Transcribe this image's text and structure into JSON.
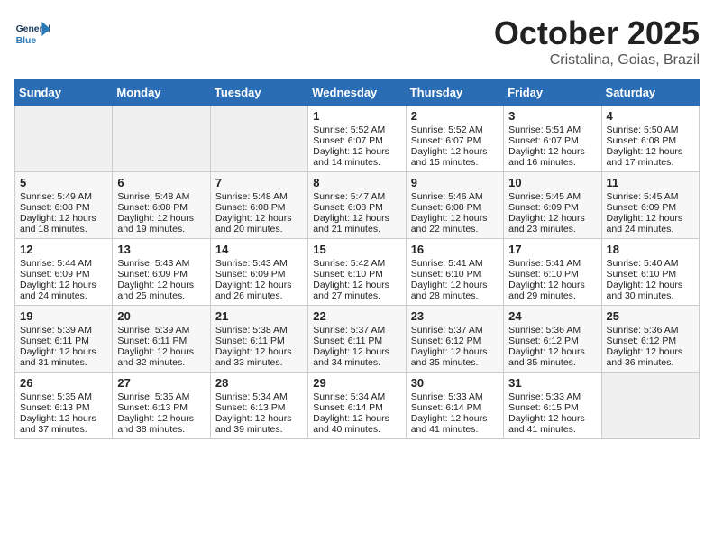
{
  "header": {
    "logo_general": "General",
    "logo_blue": "Blue",
    "month": "October 2025",
    "location": "Cristalina, Goias, Brazil"
  },
  "weekdays": [
    "Sunday",
    "Monday",
    "Tuesday",
    "Wednesday",
    "Thursday",
    "Friday",
    "Saturday"
  ],
  "weeks": [
    [
      {
        "day": "",
        "info": ""
      },
      {
        "day": "",
        "info": ""
      },
      {
        "day": "",
        "info": ""
      },
      {
        "day": "1",
        "info": "Sunrise: 5:52 AM\nSunset: 6:07 PM\nDaylight: 12 hours and 14 minutes."
      },
      {
        "day": "2",
        "info": "Sunrise: 5:52 AM\nSunset: 6:07 PM\nDaylight: 12 hours and 15 minutes."
      },
      {
        "day": "3",
        "info": "Sunrise: 5:51 AM\nSunset: 6:07 PM\nDaylight: 12 hours and 16 minutes."
      },
      {
        "day": "4",
        "info": "Sunrise: 5:50 AM\nSunset: 6:08 PM\nDaylight: 12 hours and 17 minutes."
      }
    ],
    [
      {
        "day": "5",
        "info": "Sunrise: 5:49 AM\nSunset: 6:08 PM\nDaylight: 12 hours and 18 minutes."
      },
      {
        "day": "6",
        "info": "Sunrise: 5:48 AM\nSunset: 6:08 PM\nDaylight: 12 hours and 19 minutes."
      },
      {
        "day": "7",
        "info": "Sunrise: 5:48 AM\nSunset: 6:08 PM\nDaylight: 12 hours and 20 minutes."
      },
      {
        "day": "8",
        "info": "Sunrise: 5:47 AM\nSunset: 6:08 PM\nDaylight: 12 hours and 21 minutes."
      },
      {
        "day": "9",
        "info": "Sunrise: 5:46 AM\nSunset: 6:08 PM\nDaylight: 12 hours and 22 minutes."
      },
      {
        "day": "10",
        "info": "Sunrise: 5:45 AM\nSunset: 6:09 PM\nDaylight: 12 hours and 23 minutes."
      },
      {
        "day": "11",
        "info": "Sunrise: 5:45 AM\nSunset: 6:09 PM\nDaylight: 12 hours and 24 minutes."
      }
    ],
    [
      {
        "day": "12",
        "info": "Sunrise: 5:44 AM\nSunset: 6:09 PM\nDaylight: 12 hours and 24 minutes."
      },
      {
        "day": "13",
        "info": "Sunrise: 5:43 AM\nSunset: 6:09 PM\nDaylight: 12 hours and 25 minutes."
      },
      {
        "day": "14",
        "info": "Sunrise: 5:43 AM\nSunset: 6:09 PM\nDaylight: 12 hours and 26 minutes."
      },
      {
        "day": "15",
        "info": "Sunrise: 5:42 AM\nSunset: 6:10 PM\nDaylight: 12 hours and 27 minutes."
      },
      {
        "day": "16",
        "info": "Sunrise: 5:41 AM\nSunset: 6:10 PM\nDaylight: 12 hours and 28 minutes."
      },
      {
        "day": "17",
        "info": "Sunrise: 5:41 AM\nSunset: 6:10 PM\nDaylight: 12 hours and 29 minutes."
      },
      {
        "day": "18",
        "info": "Sunrise: 5:40 AM\nSunset: 6:10 PM\nDaylight: 12 hours and 30 minutes."
      }
    ],
    [
      {
        "day": "19",
        "info": "Sunrise: 5:39 AM\nSunset: 6:11 PM\nDaylight: 12 hours and 31 minutes."
      },
      {
        "day": "20",
        "info": "Sunrise: 5:39 AM\nSunset: 6:11 PM\nDaylight: 12 hours and 32 minutes."
      },
      {
        "day": "21",
        "info": "Sunrise: 5:38 AM\nSunset: 6:11 PM\nDaylight: 12 hours and 33 minutes."
      },
      {
        "day": "22",
        "info": "Sunrise: 5:37 AM\nSunset: 6:11 PM\nDaylight: 12 hours and 34 minutes."
      },
      {
        "day": "23",
        "info": "Sunrise: 5:37 AM\nSunset: 6:12 PM\nDaylight: 12 hours and 35 minutes."
      },
      {
        "day": "24",
        "info": "Sunrise: 5:36 AM\nSunset: 6:12 PM\nDaylight: 12 hours and 35 minutes."
      },
      {
        "day": "25",
        "info": "Sunrise: 5:36 AM\nSunset: 6:12 PM\nDaylight: 12 hours and 36 minutes."
      }
    ],
    [
      {
        "day": "26",
        "info": "Sunrise: 5:35 AM\nSunset: 6:13 PM\nDaylight: 12 hours and 37 minutes."
      },
      {
        "day": "27",
        "info": "Sunrise: 5:35 AM\nSunset: 6:13 PM\nDaylight: 12 hours and 38 minutes."
      },
      {
        "day": "28",
        "info": "Sunrise: 5:34 AM\nSunset: 6:13 PM\nDaylight: 12 hours and 39 minutes."
      },
      {
        "day": "29",
        "info": "Sunrise: 5:34 AM\nSunset: 6:14 PM\nDaylight: 12 hours and 40 minutes."
      },
      {
        "day": "30",
        "info": "Sunrise: 5:33 AM\nSunset: 6:14 PM\nDaylight: 12 hours and 41 minutes."
      },
      {
        "day": "31",
        "info": "Sunrise: 5:33 AM\nSunset: 6:15 PM\nDaylight: 12 hours and 41 minutes."
      },
      {
        "day": "",
        "info": ""
      }
    ]
  ]
}
